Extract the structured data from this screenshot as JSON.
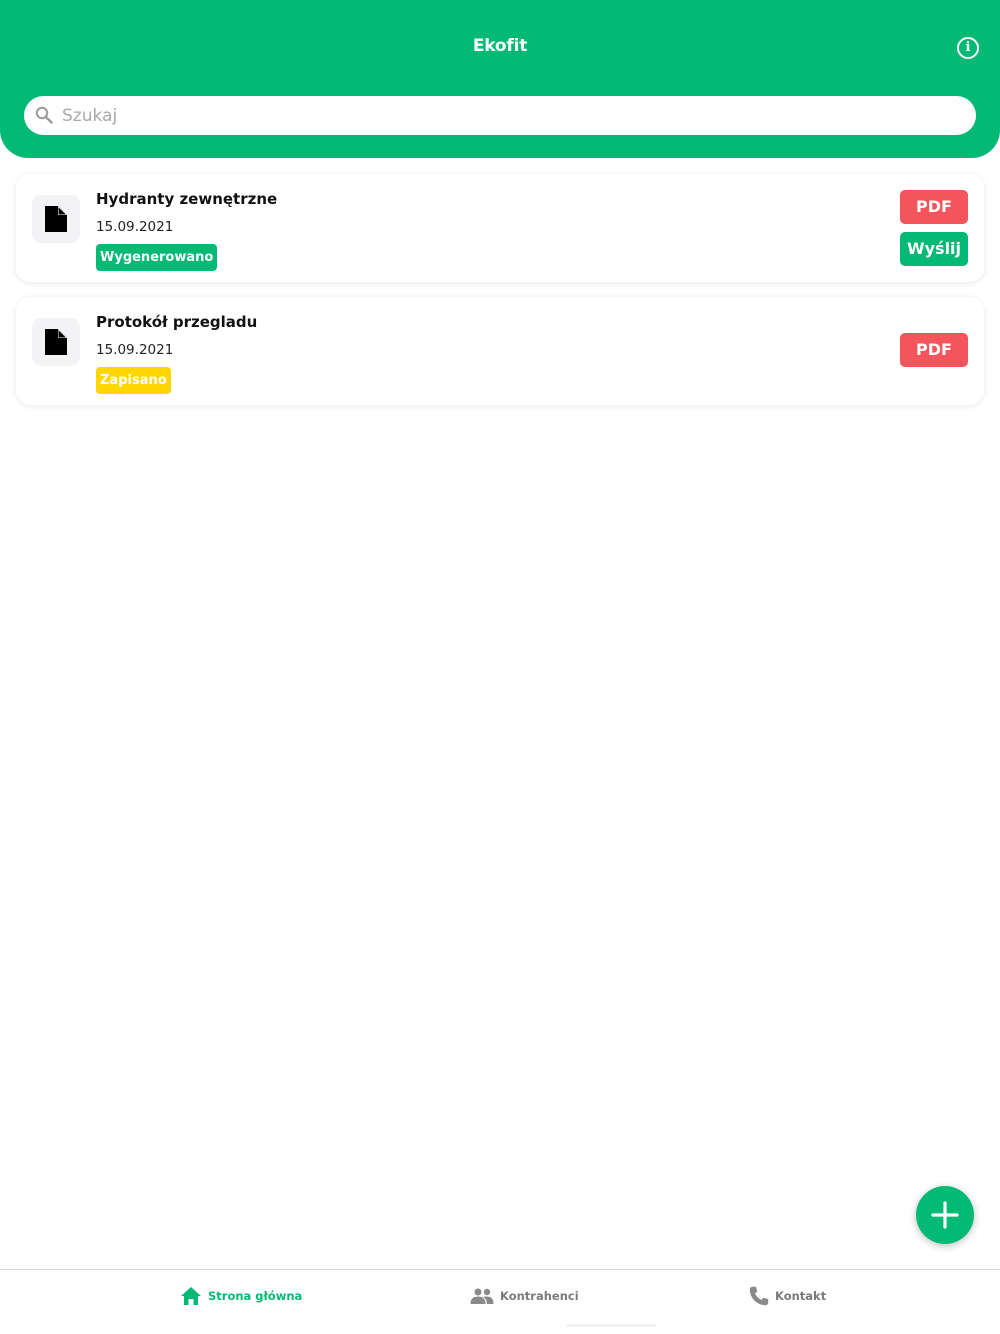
{
  "header": {
    "title": "Ekofit",
    "info_icon": "info-icon",
    "color": "#04b974"
  },
  "search": {
    "placeholder": "Szukaj",
    "value": "",
    "icon": "search-icon"
  },
  "documents": [
    {
      "title": "Hydranty zewnętrzne",
      "date": "15.09.2021",
      "status": "Wygenerowano",
      "status_color": "#04b974",
      "actions": [
        "PDF",
        "Wyślij"
      ]
    },
    {
      "title": "Protokół przegladu",
      "date": "15.09.2021",
      "status": "Zapisano",
      "status_color": "#ffd600",
      "actions": [
        "PDF"
      ]
    }
  ],
  "fab": {
    "icon": "plus-icon"
  },
  "tabbar": {
    "items": [
      {
        "label": "Strona główna",
        "icon": "home-icon",
        "active": true
      },
      {
        "label": "Kontrahenci",
        "icon": "people-icon",
        "active": false
      },
      {
        "label": "Kontakt",
        "icon": "phone-icon",
        "active": false
      }
    ]
  },
  "colors": {
    "accent": "#04b974",
    "pdf_button": "#f4545b",
    "saved_badge": "#ffd600"
  }
}
